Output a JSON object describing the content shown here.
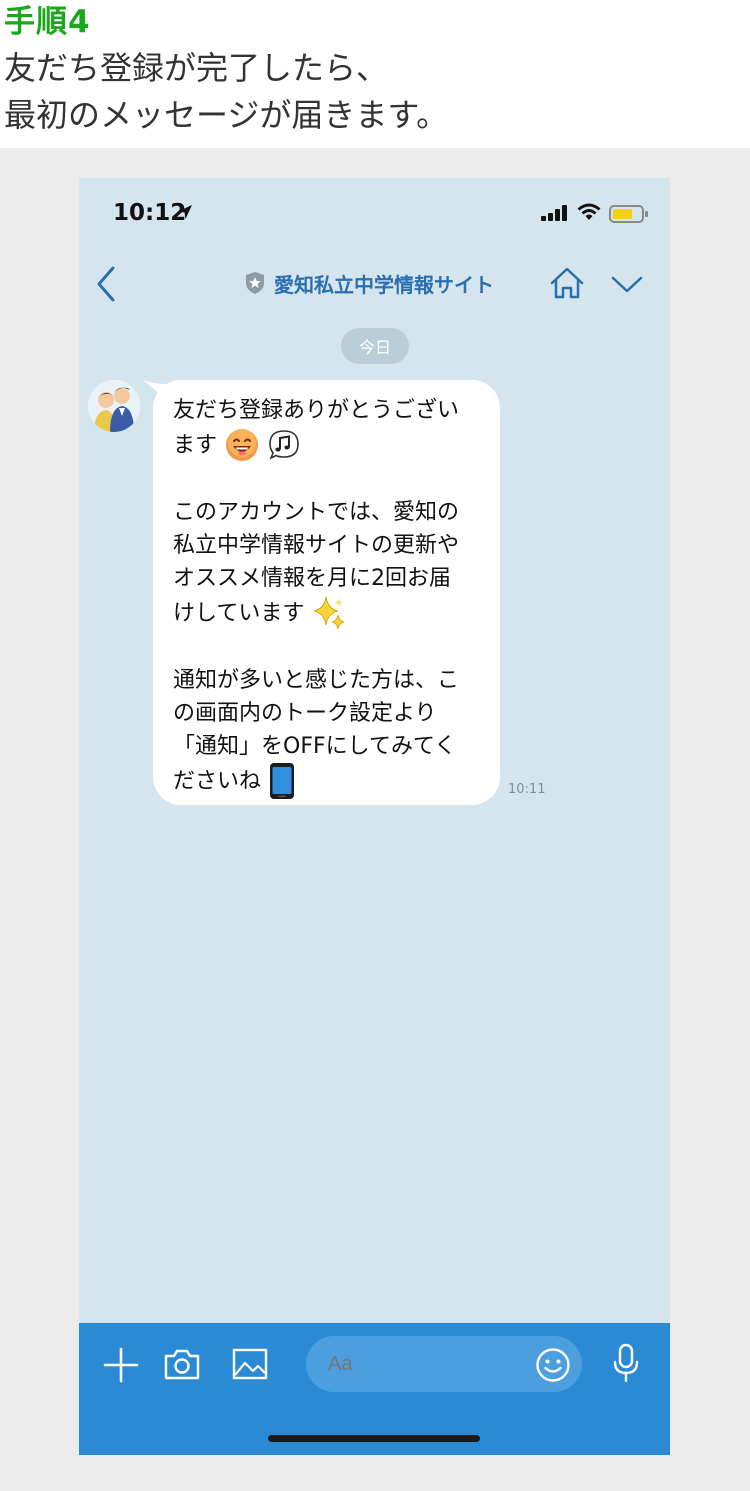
{
  "header": {
    "step_title": "手順4",
    "description_line1": "友だち登録が完了したら、",
    "description_line2": "最初のメッセージが届きます。",
    "accent_color": "#1aa81a"
  },
  "status_bar": {
    "time": "10:12",
    "icons": [
      "location-arrow-icon",
      "signal-icon",
      "wifi-icon",
      "battery-icon"
    ]
  },
  "nav": {
    "title": "愛知私立中学情報サイト",
    "icons": [
      "back-chevron-icon",
      "shield-star-icon",
      "home-icon",
      "chevron-down-icon"
    ]
  },
  "chat": {
    "date_label": "今日",
    "message": {
      "lines": [
        "友だち登録ありがとうござい",
        "ます",
        "",
        "このアカウントでは、愛知の",
        "私立中学情報サイトの更新や",
        "オススメ情報を月に2回お届",
        "けしています",
        "",
        "通知が多いと感じた方は、こ",
        "の画面内のトーク設定より",
        "「通知」をOFFにしてみてく",
        "ださいね"
      ],
      "emojis": [
        "grinning-face-icon",
        "music-note-bubble-icon",
        "sparkles-icon",
        "mobile-phone-icon"
      ],
      "time": "10:11"
    }
  },
  "input_bar": {
    "placeholder": "Aa",
    "icons": [
      "plus-icon",
      "camera-icon",
      "image-icon",
      "smile-icon",
      "mic-icon"
    ],
    "background": "#2a8ad4"
  },
  "colors": {
    "chat_background": "#d4e5ee",
    "nav_title": "#2a6fb0"
  }
}
